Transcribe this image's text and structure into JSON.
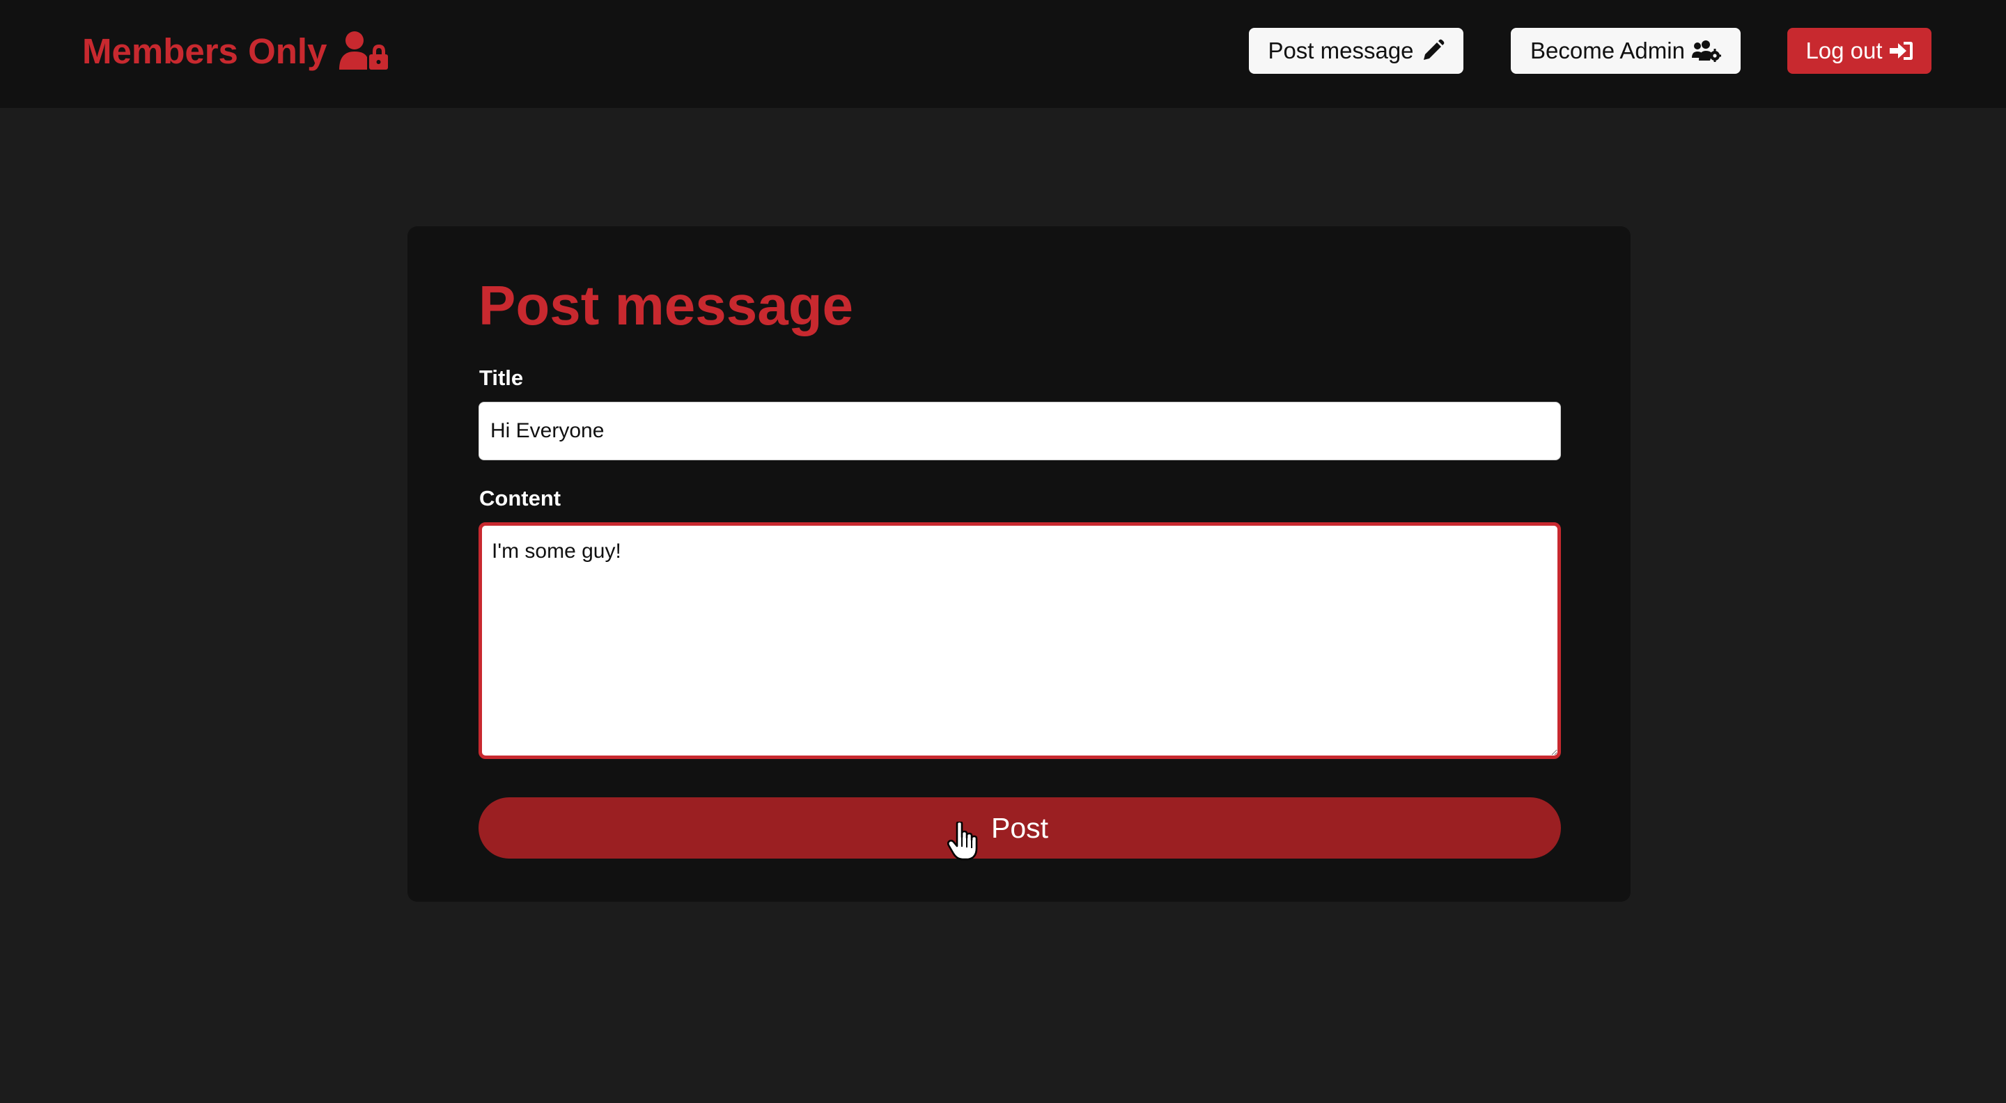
{
  "navbar": {
    "brand": "Members Only",
    "brand_icon": "user-lock-icon",
    "buttons": [
      {
        "label": "Post message",
        "icon": "pencil-icon"
      },
      {
        "label": "Become Admin",
        "icon": "users-cog-icon"
      },
      {
        "label": "Log out",
        "icon": "sign-in-icon"
      }
    ]
  },
  "form": {
    "heading": "Post message",
    "title_label": "Title",
    "title_value": "Hi Everyone",
    "content_label": "Content",
    "content_value": "I'm some guy!",
    "submit_label": "Post"
  },
  "colors": {
    "accent": "#c8292f",
    "submit": "#9b1f22",
    "navbar_bg": "#111111",
    "page_bg": "#1c1c1c",
    "card_bg": "#111111"
  }
}
